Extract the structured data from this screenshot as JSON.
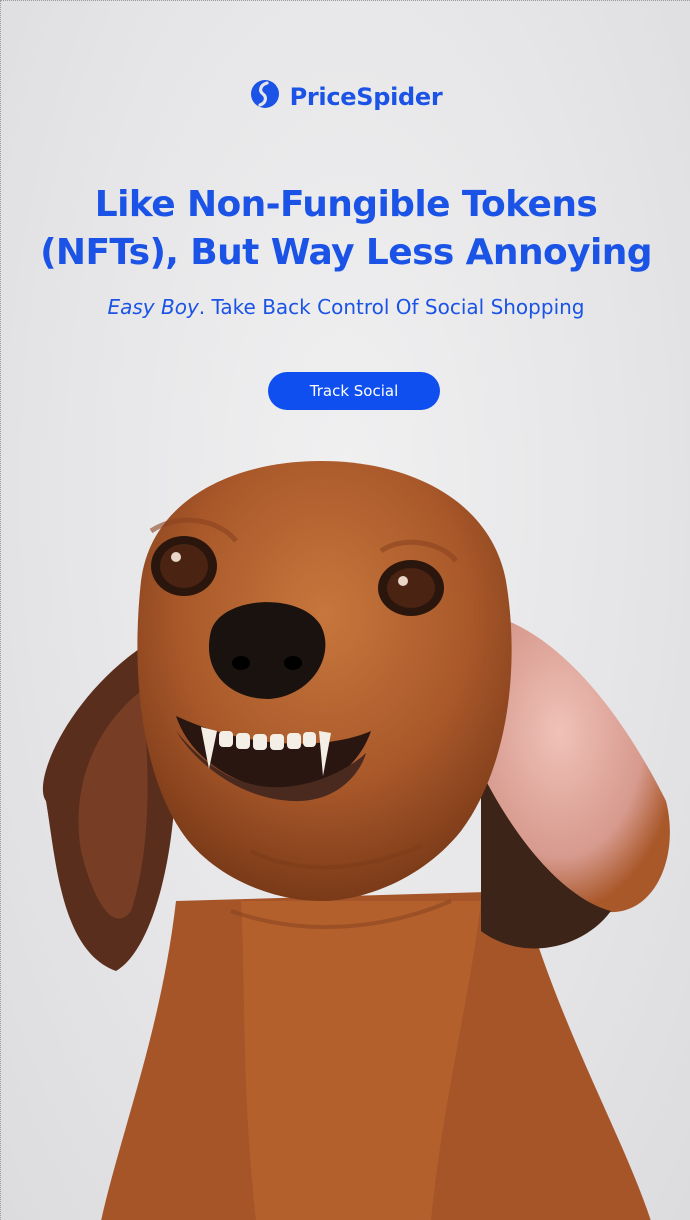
{
  "brand": {
    "logo_icon": "pricespider-logo-icon",
    "name": "PriceSpider",
    "color": "#1a53e6"
  },
  "hero": {
    "headline_line1": "Like Non-Fungible Tokens",
    "headline_line2": "(NFTs), But Way Less Annoying",
    "subline_em": "Easy Boy",
    "subline_rest": ". Take Back Control Of Social Shopping"
  },
  "cta": {
    "label": "Track Social",
    "color": "#0f4ff0"
  },
  "image": {
    "subject": "snarling-dachshund-photo"
  }
}
